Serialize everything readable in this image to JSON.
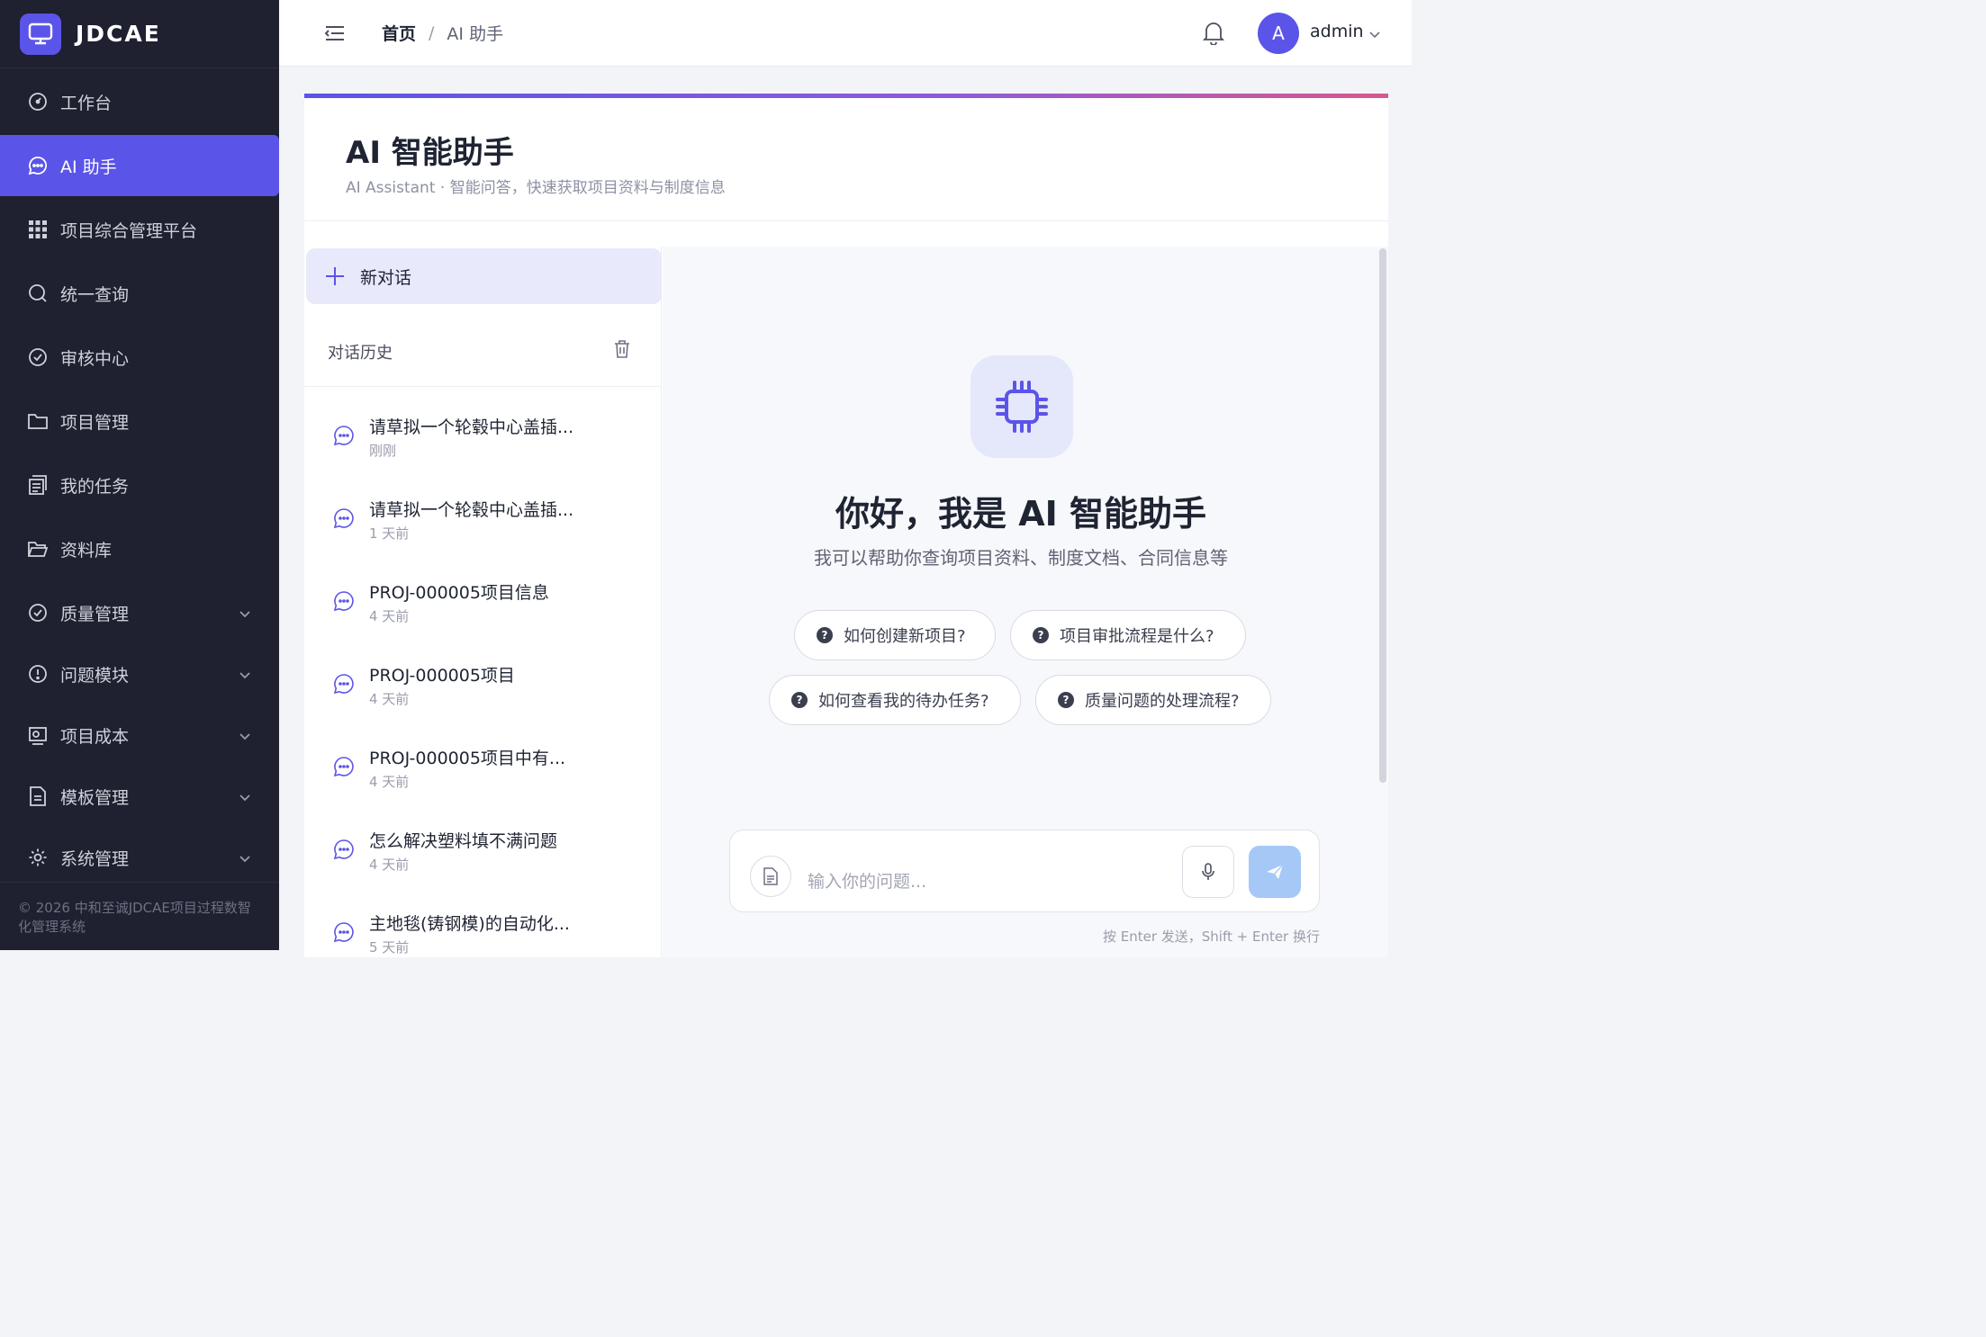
{
  "brand": {
    "name": "JDCAE"
  },
  "sidebar": {
    "items": [
      {
        "label": "工作台",
        "icon": "dashboard-icon"
      },
      {
        "label": "AI 助手",
        "icon": "chat-icon",
        "active": true
      },
      {
        "label": "项目综合管理平台",
        "icon": "grid-icon"
      },
      {
        "label": "统一查询",
        "icon": "search-icon"
      },
      {
        "label": "审核中心",
        "icon": "check-circle-icon"
      },
      {
        "label": "项目管理",
        "icon": "folder-icon"
      },
      {
        "label": "我的任务",
        "icon": "tasks-icon"
      },
      {
        "label": "资料库",
        "icon": "folder-open-icon"
      },
      {
        "label": "质量管理",
        "icon": "check-circle-icon",
        "expandable": true
      },
      {
        "label": "问题模块",
        "icon": "alert-circle-icon",
        "expandable": true
      },
      {
        "label": "项目成本",
        "icon": "cost-icon",
        "expandable": true
      },
      {
        "label": "模板管理",
        "icon": "document-icon",
        "expandable": true
      },
      {
        "label": "系统管理",
        "icon": "gear-icon",
        "expandable": true
      }
    ],
    "footer": "© 2026 中和至诚JDCAE项目过程数智化管理系统"
  },
  "header": {
    "breadcrumb_home": "首页",
    "breadcrumb_sep": "/",
    "breadcrumb_current": "AI 助手",
    "avatar_letter": "A",
    "username": "admin"
  },
  "page": {
    "title": "AI 智能助手",
    "subtitle": "AI Assistant · 智能问答，快速获取项目资料与制度信息"
  },
  "history": {
    "new_chat_label": "新对话",
    "heading": "对话历史",
    "items": [
      {
        "title": "请草拟一个轮毂中心盖插...",
        "time": "刚刚"
      },
      {
        "title": "请草拟一个轮毂中心盖插...",
        "time": "1 天前"
      },
      {
        "title": "PROJ-000005项目信息",
        "time": "4 天前"
      },
      {
        "title": "PROJ-000005项目",
        "time": "4 天前"
      },
      {
        "title": "PROJ-000005项目中有...",
        "time": "4 天前"
      },
      {
        "title": "怎么解决塑料填不满问题",
        "time": "4 天前"
      },
      {
        "title": "主地毯(铸钢模)的自动化...",
        "time": "5 天前"
      }
    ]
  },
  "chat": {
    "hero_title": "你好，我是 AI 智能助手",
    "hero_subtitle": "我可以帮助你查询项目资料、制度文档、合同信息等",
    "suggestions": [
      "如何创建新项目?",
      "项目审批流程是什么?",
      "如何查看我的待办任务?",
      "质量问题的处理流程?"
    ],
    "input_placeholder": "输入你的问题...",
    "hint": "按 Enter 发送，Shift + Enter 换行"
  },
  "colors": {
    "accent": "#5b54e8",
    "sidebar_bg": "#1f2030",
    "send_button": "#a5c8f7"
  }
}
